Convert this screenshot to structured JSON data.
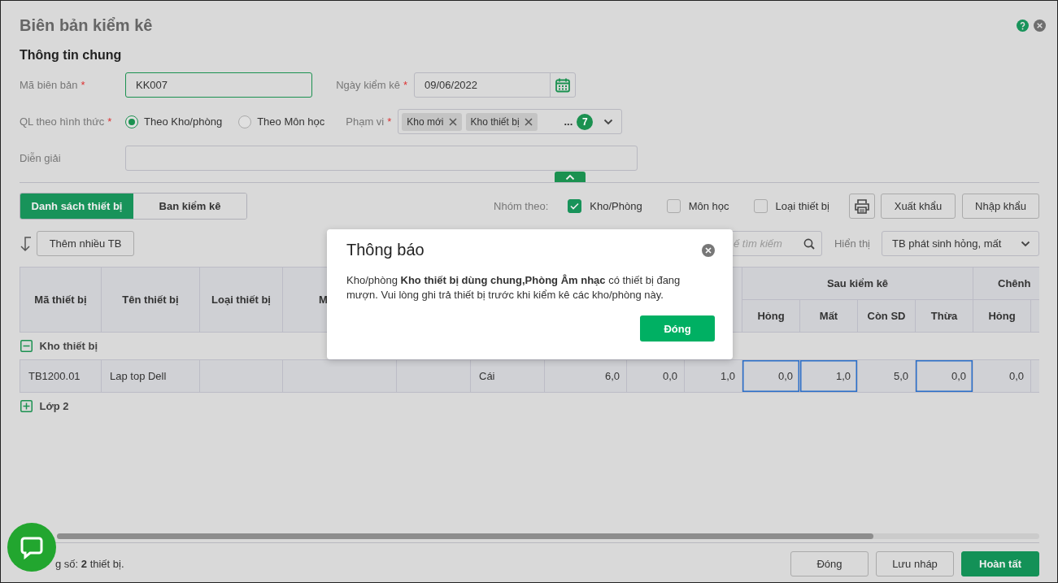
{
  "window": {
    "title": "Biên bản kiểm kê"
  },
  "section_title": "Thông tin chung",
  "form": {
    "code": {
      "label": "Mã biên bản",
      "required_mark": "*",
      "value": "KK007",
      "focused": true
    },
    "date": {
      "label": "Ngày kiểm kê",
      "required_mark": "*",
      "value": "09/06/2022"
    },
    "mode": {
      "label": "QL theo hình thức",
      "required_mark": "*",
      "options": [
        {
          "label": "Theo Kho/phòng",
          "selected": true
        },
        {
          "label": "Theo Môn học",
          "selected": false
        }
      ]
    },
    "scope": {
      "label": "Phạm vi",
      "required_mark": "*",
      "tags": [
        "Kho mới",
        "Kho thiết bị"
      ],
      "more": "...",
      "count": "7"
    },
    "description": {
      "label": "Diễn giải"
    }
  },
  "tabs": [
    {
      "label": "Danh sách thiết bị",
      "selected": true
    },
    {
      "label": "Ban kiểm kê",
      "selected": false
    }
  ],
  "group_by": {
    "label": "Nhóm theo:",
    "options": [
      {
        "label": "Kho/Phòng",
        "checked": true
      },
      {
        "label": "Môn học",
        "checked": false
      },
      {
        "label": "Loại thiết bị",
        "checked": false
      }
    ]
  },
  "export_buttons": [
    "Xuất khẩu",
    "Nhập khẩu"
  ],
  "add_button": "Thêm nhiều TB",
  "search": {
    "placeholder": "ế tìm kiếm"
  },
  "display": {
    "label": "Hiển thị",
    "value": "TB phát sinh hỏng, mất"
  },
  "table": {
    "columns": [
      "Mã thiết bị",
      "Tên thiết bị",
      "Loại thiết bị",
      "M"
    ],
    "groups": [
      {
        "label": "Sau kiểm kê",
        "columns": [
          "Hỏng",
          "Mất",
          "Còn SD",
          "Thừa"
        ]
      },
      {
        "label": "Chênh",
        "columns": [
          "Hỏng"
        ]
      }
    ],
    "sections": [
      {
        "label": "Kho thiết bị",
        "expanded": true,
        "rows": [
          {
            "cells": [
              {
                "text": "TB1200.01",
                "input": false
              },
              {
                "text": "Lap top Dell",
                "input": false
              },
              {
                "input": false
              },
              {
                "input": false
              },
              {
                "input": false
              },
              {
                "text": "Cái",
                "input": false
              },
              {
                "text": "6,0",
                "input": false
              },
              {
                "text": "0,0",
                "input": false
              },
              {
                "text": "1,0",
                "input": false
              },
              {
                "text": "0,0",
                "input": true
              },
              {
                "text": "1,0",
                "input": true
              },
              {
                "text": "5,0",
                "input": false
              },
              {
                "text": "0,0",
                "input": true
              },
              {
                "text": "0,0",
                "input": false
              }
            ]
          }
        ]
      },
      {
        "label": "Lớp 2",
        "expanded": false
      }
    ]
  },
  "footer": {
    "summary": "g số: **2** thiết bị.",
    "buttons": [
      {
        "label": "Đóng",
        "kind": "secondary"
      },
      {
        "label": "Lưu nháp",
        "kind": "secondary"
      },
      {
        "label": "Hoàn tất",
        "kind": "primary"
      }
    ]
  },
  "dialog": {
    "title": "Thông báo",
    "message": "Kho/phòng **Kho thiết bị dùng chung,Phòng Âm nhạc** có thiết bị đang mượn. Vui lòng ghi trả thiết bị trước khi kiểm kê các kho/phòng này.",
    "button": "Đóng"
  }
}
